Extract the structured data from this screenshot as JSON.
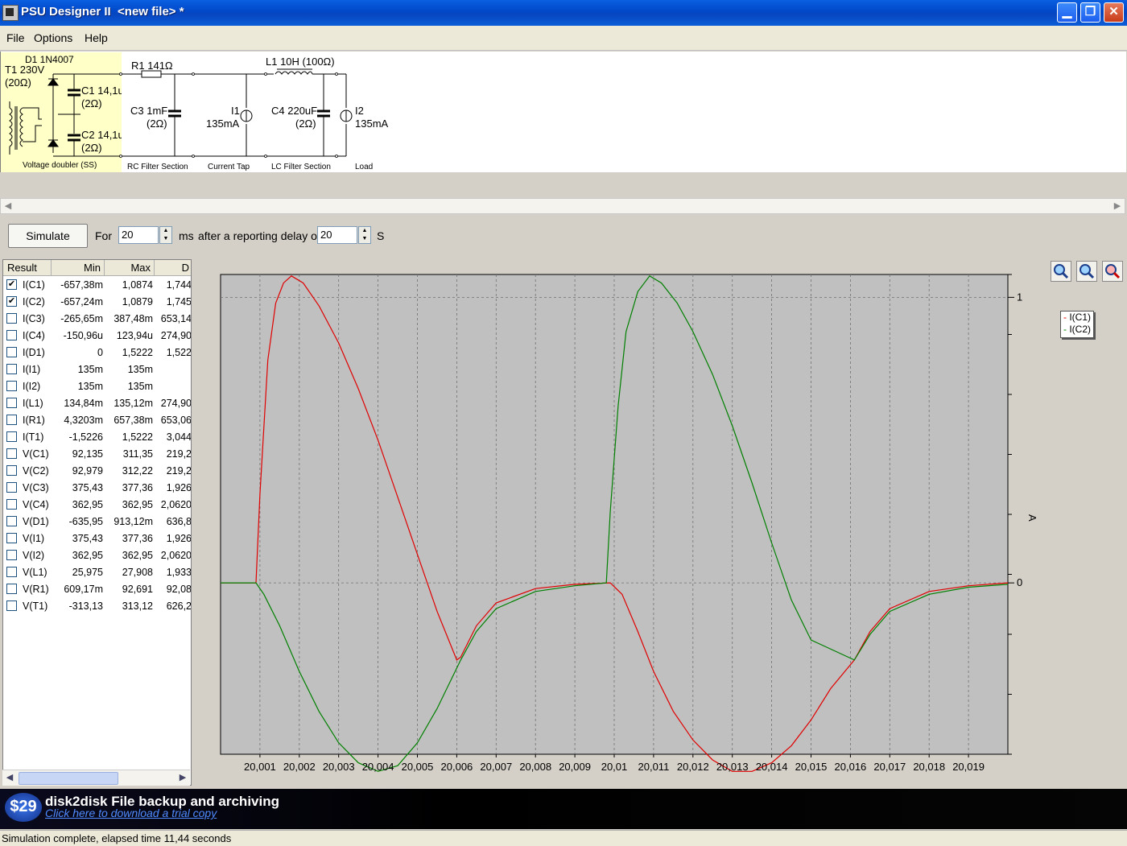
{
  "window": {
    "title": "PSU Designer II  <new file> *"
  },
  "menu": [
    "File",
    "Options",
    "Help"
  ],
  "circuit": {
    "d1": "D1 1N4007",
    "t1": "T1 230V",
    "t1_r": "(20Ω)",
    "c1": "C1 14,1u",
    "c1_r": "(2Ω)",
    "c2": "C2 14,1u",
    "c2_r": "(2Ω)",
    "r1": "R1 141Ω",
    "l1": "L1 10H (100Ω)",
    "c3": "C3 1mF",
    "c3_r": "(2Ω)",
    "i1": "I1",
    "i1_val": "135mA",
    "c4": "C4 220uF",
    "c4_r": "(2Ω)",
    "i2": "I2",
    "i2_val": "135mA",
    "sections": [
      "Voltage doubler (SS)",
      "RC Filter Section",
      "Current Tap",
      "LC Filter Section",
      "Load"
    ]
  },
  "sim": {
    "button": "Simulate",
    "for_label": "For",
    "duration": "20",
    "ms_label": "ms",
    "delay_label": "after a reporting delay of",
    "delay": "20",
    "s_label": "S"
  },
  "results": {
    "columns": [
      "Result",
      "Min",
      "Max",
      "D"
    ],
    "rows": [
      {
        "checked": true,
        "name": "I(C1)",
        "min": "-657,38m",
        "max": "1,0874",
        "d": "1,744"
      },
      {
        "checked": true,
        "name": "I(C2)",
        "min": "-657,24m",
        "max": "1,0879",
        "d": "1,745"
      },
      {
        "checked": false,
        "name": "I(C3)",
        "min": "-265,65m",
        "max": "387,48m",
        "d": "653,14"
      },
      {
        "checked": false,
        "name": "I(C4)",
        "min": "-150,96u",
        "max": "123,94u",
        "d": "274,90"
      },
      {
        "checked": false,
        "name": "I(D1)",
        "min": "0",
        "max": "1,5222",
        "d": "1,522"
      },
      {
        "checked": false,
        "name": "I(I1)",
        "min": "135m",
        "max": "135m",
        "d": ""
      },
      {
        "checked": false,
        "name": "I(I2)",
        "min": "135m",
        "max": "135m",
        "d": ""
      },
      {
        "checked": false,
        "name": "I(L1)",
        "min": "134,84m",
        "max": "135,12m",
        "d": "274,90"
      },
      {
        "checked": false,
        "name": "I(R1)",
        "min": "4,3203m",
        "max": "657,38m",
        "d": "653,06"
      },
      {
        "checked": false,
        "name": "I(T1)",
        "min": "-1,5226",
        "max": "1,5222",
        "d": "3,044"
      },
      {
        "checked": false,
        "name": "V(C1)",
        "min": "92,135",
        "max": "311,35",
        "d": "219,2"
      },
      {
        "checked": false,
        "name": "V(C2)",
        "min": "92,979",
        "max": "312,22",
        "d": "219,2"
      },
      {
        "checked": false,
        "name": "V(C3)",
        "min": "375,43",
        "max": "377,36",
        "d": "1,926"
      },
      {
        "checked": false,
        "name": "V(C4)",
        "min": "362,95",
        "max": "362,95",
        "d": "2,0620"
      },
      {
        "checked": false,
        "name": "V(D1)",
        "min": "-635,95",
        "max": "913,12m",
        "d": "636,8"
      },
      {
        "checked": false,
        "name": "V(I1)",
        "min": "375,43",
        "max": "377,36",
        "d": "1,926"
      },
      {
        "checked": false,
        "name": "V(I2)",
        "min": "362,95",
        "max": "362,95",
        "d": "2,0620"
      },
      {
        "checked": false,
        "name": "V(L1)",
        "min": "25,975",
        "max": "27,908",
        "d": "1,933"
      },
      {
        "checked": false,
        "name": "V(R1)",
        "min": "609,17m",
        "max": "92,691",
        "d": "92,08"
      },
      {
        "checked": false,
        "name": "V(T1)",
        "min": "-313,13",
        "max": "313,12",
        "d": "626,2"
      }
    ]
  },
  "chart_data": {
    "type": "line",
    "title": "",
    "xlabel": "",
    "ylabel": "A",
    "xlim": [
      20.0,
      20.02
    ],
    "ylim": [
      -0.6,
      1.08
    ],
    "y_ticks": [
      {
        "v": 1,
        "label": "1"
      },
      {
        "v": 0,
        "label": "0"
      }
    ],
    "x_ticks": [
      "20,001",
      "20,002",
      "20,003",
      "20,004",
      "20,005",
      "20,006",
      "20,007",
      "20,008",
      "20,009",
      "20,01",
      "20,011",
      "20,012",
      "20,013",
      "20,014",
      "20,015",
      "20,016",
      "20,017",
      "20,018",
      "20,019"
    ],
    "grid": true,
    "legend": "right",
    "series": [
      {
        "name": "I(C1)",
        "color": "#e00000",
        "points": [
          [
            20.0,
            0
          ],
          [
            20.0009,
            0
          ],
          [
            20.001,
            0.31
          ],
          [
            20.0012,
            0.78
          ],
          [
            20.0014,
            0.98
          ],
          [
            20.0016,
            1.05
          ],
          [
            20.0018,
            1.075
          ],
          [
            20.0021,
            1.05
          ],
          [
            20.0025,
            0.97
          ],
          [
            20.003,
            0.84
          ],
          [
            20.0035,
            0.68
          ],
          [
            20.004,
            0.5
          ],
          [
            20.0045,
            0.3
          ],
          [
            20.005,
            0.1
          ],
          [
            20.0055,
            -0.1
          ],
          [
            20.006,
            -0.27
          ],
          [
            20.0061,
            -0.26
          ],
          [
            20.0065,
            -0.15
          ],
          [
            20.007,
            -0.07
          ],
          [
            20.008,
            -0.02
          ],
          [
            20.009,
            -0.005
          ],
          [
            20.0099,
            0
          ],
          [
            20.0102,
            -0.04
          ],
          [
            20.0106,
            -0.17
          ],
          [
            20.011,
            -0.31
          ],
          [
            20.0115,
            -0.45
          ],
          [
            20.012,
            -0.55
          ],
          [
            20.0125,
            -0.62
          ],
          [
            20.013,
            -0.66
          ],
          [
            20.0135,
            -0.66
          ],
          [
            20.014,
            -0.63
          ],
          [
            20.0145,
            -0.57
          ],
          [
            20.015,
            -0.48
          ],
          [
            20.0155,
            -0.37
          ],
          [
            20.0161,
            -0.27
          ],
          [
            20.0165,
            -0.17
          ],
          [
            20.017,
            -0.09
          ],
          [
            20.018,
            -0.03
          ],
          [
            20.019,
            -0.01
          ],
          [
            20.02,
            0
          ]
        ]
      },
      {
        "name": "I(C2)",
        "color": "#008000",
        "points": [
          [
            20.0,
            0
          ],
          [
            20.0009,
            0
          ],
          [
            20.0011,
            -0.04
          ],
          [
            20.0015,
            -0.15
          ],
          [
            20.002,
            -0.31
          ],
          [
            20.0025,
            -0.45
          ],
          [
            20.003,
            -0.56
          ],
          [
            20.0035,
            -0.63
          ],
          [
            20.004,
            -0.66
          ],
          [
            20.0045,
            -0.64
          ],
          [
            20.005,
            -0.56
          ],
          [
            20.0055,
            -0.44
          ],
          [
            20.0061,
            -0.27
          ],
          [
            20.0065,
            -0.17
          ],
          [
            20.007,
            -0.09
          ],
          [
            20.008,
            -0.03
          ],
          [
            20.009,
            -0.01
          ],
          [
            20.0098,
            0
          ],
          [
            20.0099,
            0.25
          ],
          [
            20.0101,
            0.62
          ],
          [
            20.0103,
            0.88
          ],
          [
            20.0106,
            1.02
          ],
          [
            20.0109,
            1.075
          ],
          [
            20.0112,
            1.05
          ],
          [
            20.0116,
            0.98
          ],
          [
            20.012,
            0.88
          ],
          [
            20.0125,
            0.73
          ],
          [
            20.013,
            0.55
          ],
          [
            20.0135,
            0.35
          ],
          [
            20.014,
            0.14
          ],
          [
            20.0145,
            -0.06
          ],
          [
            20.015,
            -0.2
          ],
          [
            20.0161,
            -0.27
          ],
          [
            20.0165,
            -0.18
          ],
          [
            20.017,
            -0.1
          ],
          [
            20.018,
            -0.04
          ],
          [
            20.019,
            -0.015
          ],
          [
            20.02,
            -0.005
          ]
        ]
      }
    ]
  },
  "ad": {
    "price": "$29",
    "title": "disk2disk File backup and archiving",
    "link": "Click here to download a trial copy"
  },
  "status": "Simulation complete, elapsed time 11,44 seconds"
}
